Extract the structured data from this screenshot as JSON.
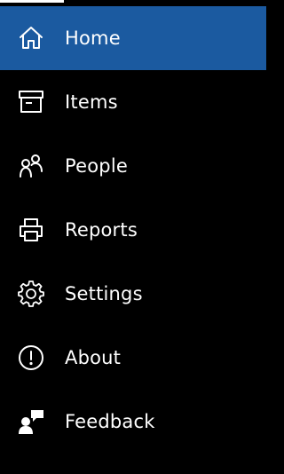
{
  "nav": {
    "items": [
      {
        "label": "Home",
        "icon": "home-icon",
        "selected": true
      },
      {
        "label": "Items",
        "icon": "archive-box-icon",
        "selected": false
      },
      {
        "label": "People",
        "icon": "people-icon",
        "selected": false
      },
      {
        "label": "Reports",
        "icon": "printer-icon",
        "selected": false
      },
      {
        "label": "Settings",
        "icon": "gear-icon",
        "selected": false
      },
      {
        "label": "About",
        "icon": "info-exclamation-icon",
        "selected": false
      },
      {
        "label": "Feedback",
        "icon": "feedback-icon",
        "selected": false
      }
    ]
  },
  "colors": {
    "background": "#000000",
    "selected_background": "#1b5aa0",
    "text": "#ffffff"
  }
}
